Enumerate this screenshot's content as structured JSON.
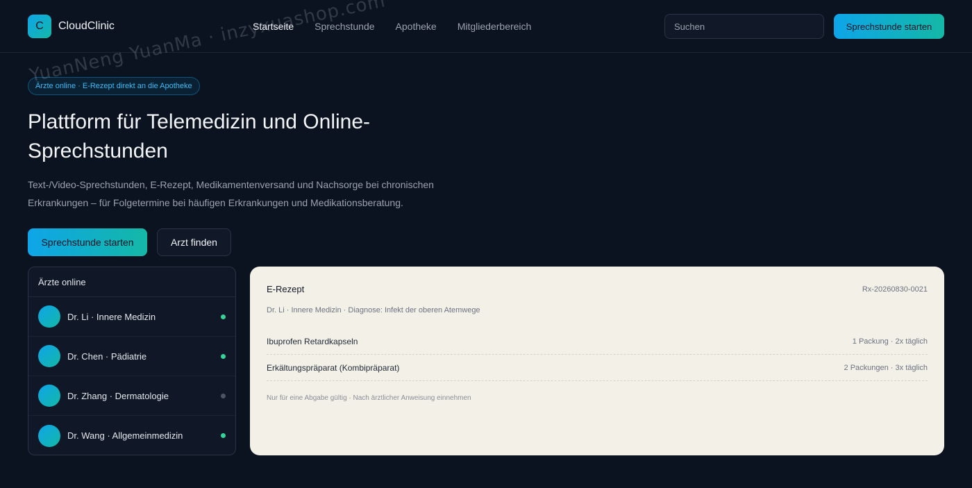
{
  "brand": {
    "logo_letter": "C",
    "name": "CloudClinic"
  },
  "nav": {
    "items": [
      {
        "label": "Startseite",
        "active": true
      },
      {
        "label": "Sprechstunde"
      },
      {
        "label": "Apotheke"
      },
      {
        "label": "Mitgliederbereich"
      }
    ]
  },
  "search": {
    "placeholder": "Suchen"
  },
  "header_cta": "Sprechstunde starten",
  "hero": {
    "pill": "Ärzte online · E-Rezept direkt an die Apotheke",
    "title": "Plattform für Telemedizin und Online-Sprechstunden",
    "subtitle": "Text-/Video-Sprechstunden, E-Rezept, Medikamentenversand und Nachsorge bei chronischen Erkrankungen – für Folgetermine bei häufigen Erkrankungen und Medikationsberatung.",
    "primary_button": "Sprechstunde starten",
    "secondary_button": "Arzt finden"
  },
  "doctors": {
    "title": "Ärzte online",
    "items": [
      {
        "label": "Dr. Li · Innere Medizin",
        "status": "online"
      },
      {
        "label": "Dr. Chen · Pädiatrie",
        "status": "online"
      },
      {
        "label": "Dr. Zhang · Dermatologie",
        "status": "offline"
      },
      {
        "label": "Dr. Wang · Allgemeinmedizin",
        "status": "online"
      }
    ]
  },
  "prescription": {
    "title": "E-Rezept",
    "id": "Rx-20260830-0021",
    "meta": "Dr. Li · Innere Medizin · Diagnose: Infekt der oberen Atemwege",
    "items": [
      {
        "name": "Ibuprofen Retardkapseln",
        "dose": "1 Packung · 2x täglich"
      },
      {
        "name": "Erkältungspräparat (Kombipräparat)",
        "dose": "2 Packungen · 3x täglich"
      }
    ],
    "note": "Nur für eine Abgabe gültig · Nach ärztlicher Anweisung einnehmen"
  },
  "watermark": "YuanNeng YuanMa · inzyxuashop.com",
  "colors": {
    "background": "#0b1220",
    "accent_start": "#0ea5e9",
    "accent_end": "#14b8a6",
    "online": "#34d399",
    "offline": "#4b5563",
    "card": "#f3f0e8"
  }
}
